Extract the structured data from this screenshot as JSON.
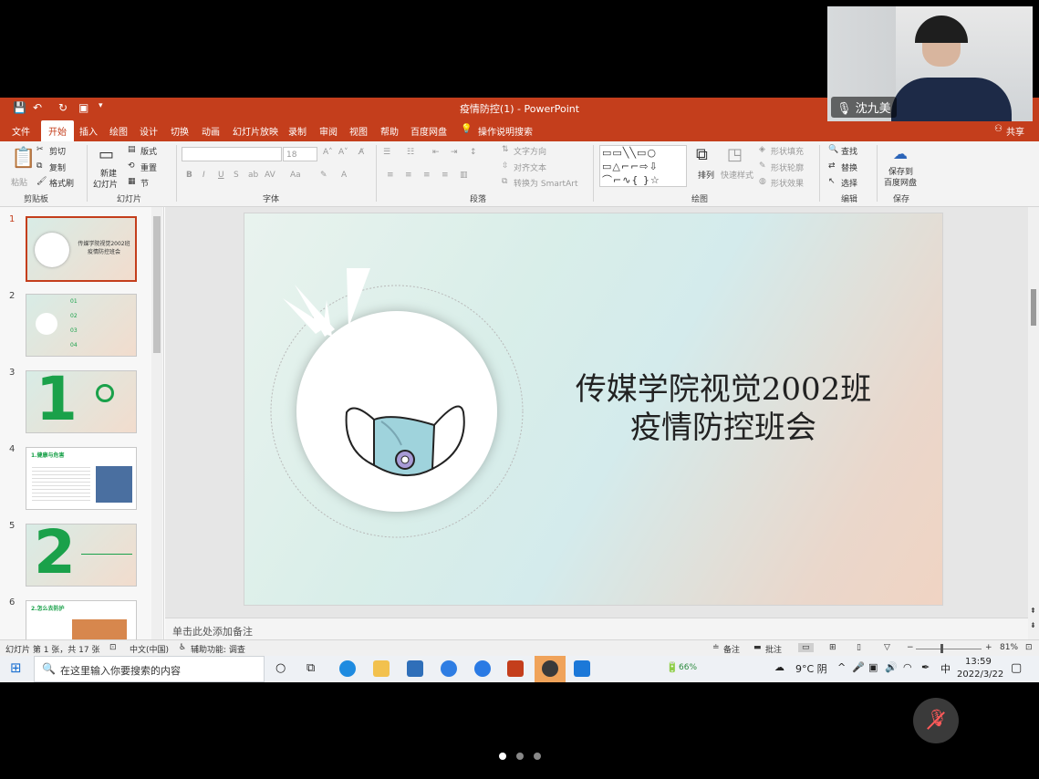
{
  "window": {
    "title": "疫情防控(1) - PowerPoint",
    "share_label": "共享"
  },
  "menu": [
    "文件",
    "开始",
    "插入",
    "绘图",
    "设计",
    "切换",
    "动画",
    "幻灯片放映",
    "录制",
    "审阅",
    "视图",
    "帮助",
    "百度网盘",
    "操作说明搜索"
  ],
  "ribbon": {
    "paste": "粘贴",
    "cut": "剪切",
    "copy": "复制",
    "format_painter": "格式刷",
    "new_slide": "新建",
    "new_slide2": "幻灯片",
    "layout": "版式",
    "reset": "重置",
    "section": "节",
    "font_size": "18",
    "text_direction": "文字方向",
    "align_text": "对齐文本",
    "smartart": "转换为 SmartArt",
    "arrange": "排列",
    "quick_styles": "快速样式",
    "shape_fill": "形状填充",
    "shape_outline": "形状轮廓",
    "shape_effects": "形状效果",
    "find": "查找",
    "replace": "替换",
    "select": "选择",
    "save_to": "保存到",
    "baidu": "百度网盘",
    "groups": [
      "剪贴板",
      "幻灯片",
      "字体",
      "段落",
      "绘图",
      "编辑",
      "保存"
    ]
  },
  "thumbnails": [
    {
      "num": "1",
      "text": "传媒学院视觉2002班 疫情防控班会"
    },
    {
      "num": "2",
      "items": [
        "01",
        "02",
        "03",
        "04"
      ]
    },
    {
      "num": "3",
      "big": "1"
    },
    {
      "num": "4",
      "heading": "1.健康与危害"
    },
    {
      "num": "5",
      "big": "2"
    },
    {
      "num": "6",
      "heading": "2.怎么去防护"
    }
  ],
  "slide": {
    "title_line1": "传媒学院视觉2002班",
    "title_line2": "疫情防控班会"
  },
  "notes_placeholder": "单击此处添加备注",
  "status": {
    "slide_count": "幻灯片 第 1 张，共 17 张",
    "language": "中文(中国)",
    "accessibility": "辅助功能: 调查",
    "notes": "备注",
    "comments": "批注",
    "zoom": "81%"
  },
  "taskbar": {
    "search_placeholder": "在这里输入你要搜索的内容",
    "battery": "66%",
    "weather": "9°C 阴",
    "ime": "中",
    "time": "13:59",
    "date": "2022/3/22"
  },
  "video": {
    "participant_name": "沈九美"
  },
  "colors": {
    "ppt_accent": "#c43e1c",
    "green": "#1aa14a"
  }
}
